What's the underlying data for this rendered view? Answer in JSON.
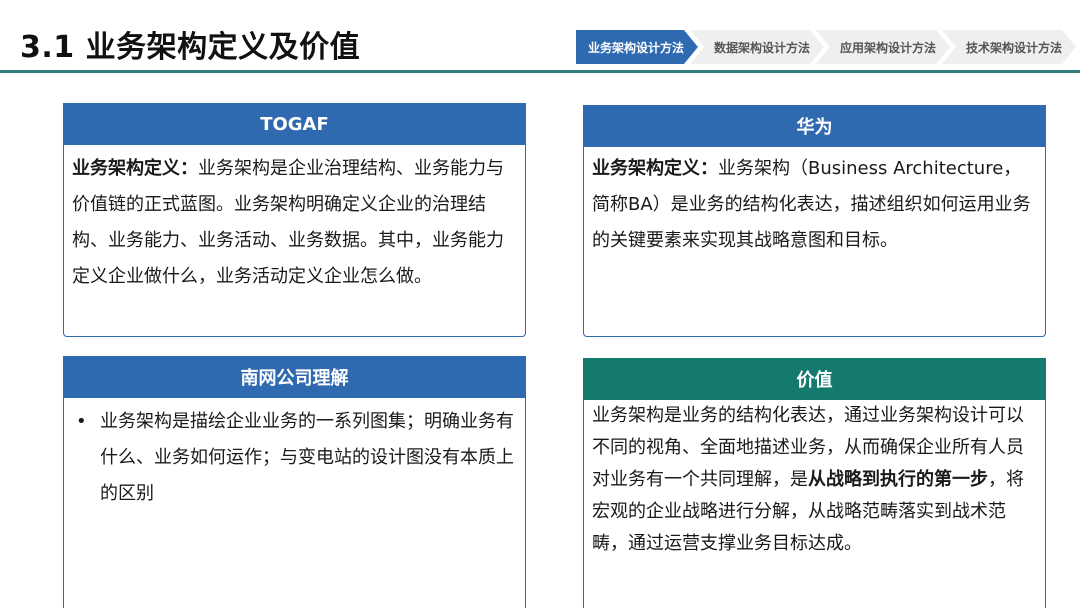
{
  "header": {
    "title": "3.1 业务架构定义及价值",
    "steps": [
      {
        "label": "业务架构设计方法",
        "active": true
      },
      {
        "label": "数据架构设计方法",
        "active": false
      },
      {
        "label": "应用架构设计方法",
        "active": false
      },
      {
        "label": "技术架构设计方法",
        "active": false
      }
    ]
  },
  "togaf": {
    "title": "TOGAF",
    "term": "业务架构定义：",
    "text": "业务架构是企业治理结构、业务能力与价值链的正式蓝图。业务架构明确定义企业的治理结构、业务能力、业务活动、业务数据。其中，业务能力定义企业做什么，业务活动定义企业怎么做。"
  },
  "huawei": {
    "title": "华为",
    "term": "业务架构定义：",
    "text": "业务架构（Business Architecture，简称BA）是业务的结构化表达，描述组织如何运用业务的关键要素来实现其战略意图和目标。"
  },
  "nanwang": {
    "title": "南网公司理解",
    "bullet": "•",
    "items": [
      "业务架构是描绘企业业务的一系列图集；明确业务有什么、业务如何运作；与变电站的设计图没有本质上的区别"
    ]
  },
  "value": {
    "title": "价值",
    "text_before": "业务架构是业务的结构化表达，通过业务架构设计可以不同的视角、全面地描述业务，从而确保企业所有人员对业务有一个共同理解，是",
    "text_bold": "从战略到执行的第一步",
    "text_after": "，将宏观的企业战略进行分解，从战略范畴落实到战术范畴，通过运营支撑业务目标达成。"
  },
  "colors": {
    "blue": "#2f6ab0",
    "teal": "#147a6e",
    "rule": "#2e7f7c"
  }
}
